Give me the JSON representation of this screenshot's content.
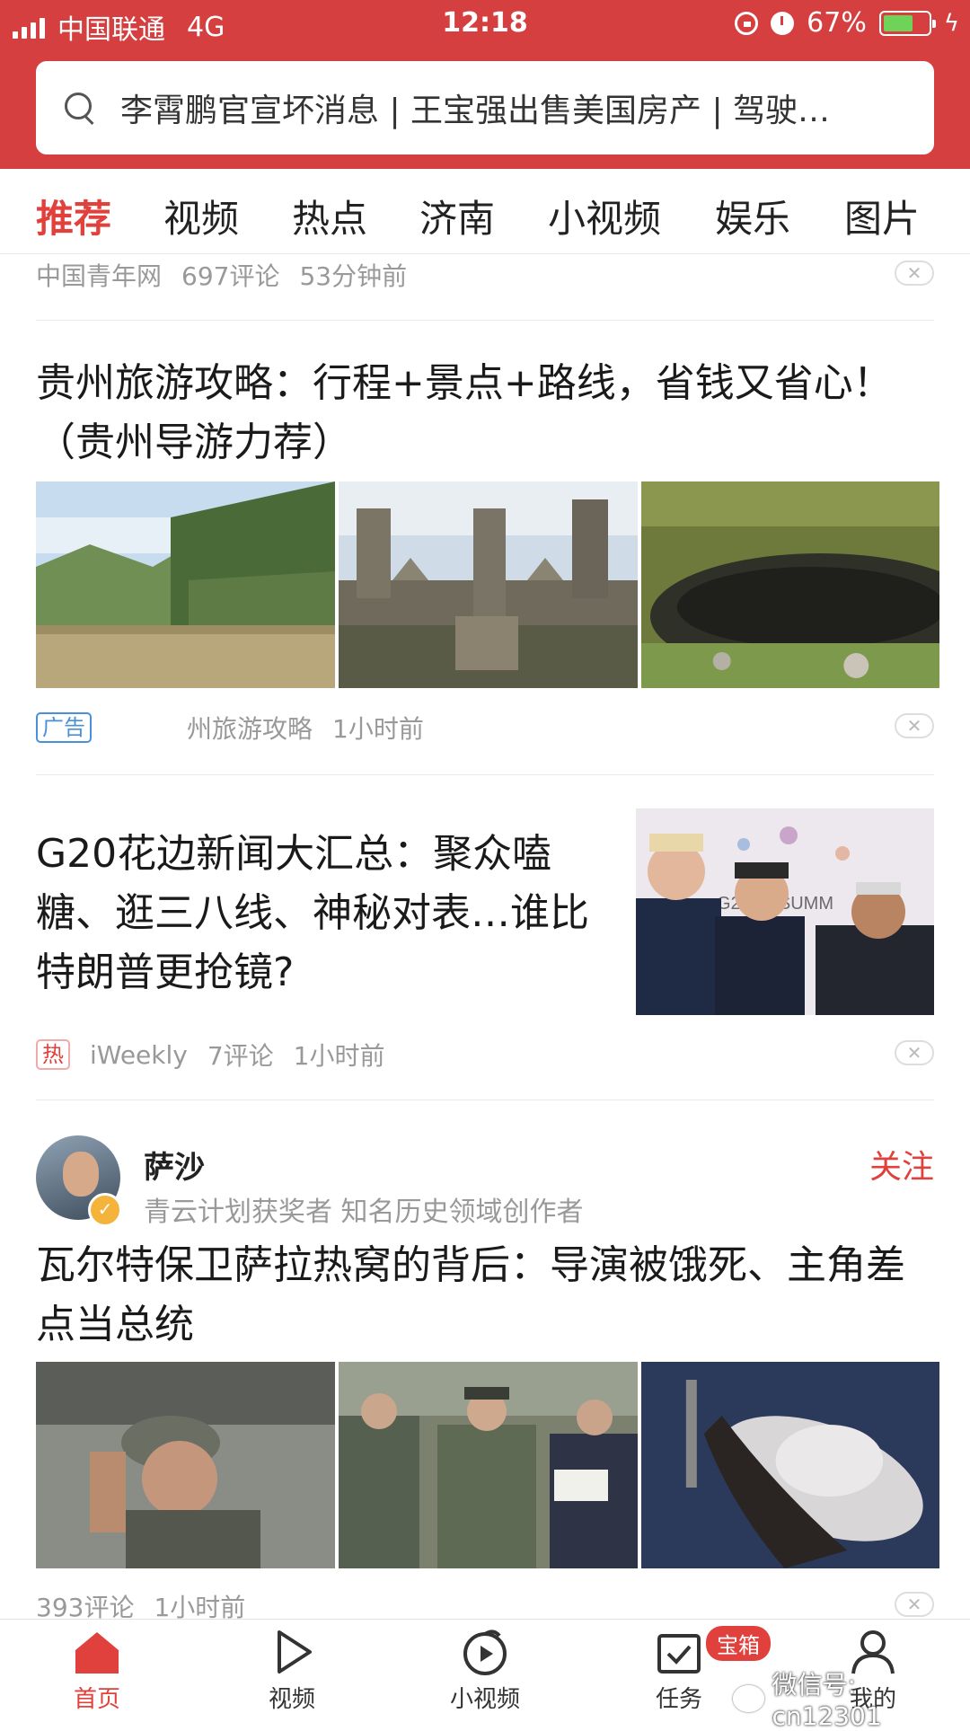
{
  "status_bar": {
    "carrier": "中国联通",
    "network": "4G",
    "time": "12:18",
    "battery": "67%",
    "battery_level": 0.67
  },
  "search": {
    "text": "李霄鹏官宣坏消息 | 王宝强出售美国房产 | 驾驶…"
  },
  "tabs": [
    "推荐",
    "视频",
    "热点",
    "济南",
    "小视频",
    "娱乐",
    "图片"
  ],
  "feed": {
    "top_meta": {
      "source": "中国青年网",
      "comments": "697评论",
      "time": "53分钟前"
    },
    "ad_article": {
      "title": "贵州旅游攻略：行程+景点+路线，省钱又省心！（贵州导游力荐）",
      "badge": "广告",
      "source": "州旅游攻略",
      "time": "1小时前",
      "images": [
        "river-cliff-photo",
        "stone-sculpture-wall-photo",
        "mossy-cave-photo"
      ]
    },
    "g20_article": {
      "title": "G20花边新闻大汇总：聚众嗑糖、逛三八线、神秘对表…谁比特朗普更抢镜?",
      "badge": "热",
      "source": "iWeekly",
      "comments": "7评论",
      "time": "1小时前",
      "image": "g20-leaders-photo"
    },
    "author_article": {
      "author_name": "萨沙",
      "author_desc": "青云计划获奖者 知名历史领域创作者",
      "follow": "关注",
      "title": "瓦尔特保卫萨拉热窝的背后：导演被饿死、主角差点当总统",
      "comments": "393评论",
      "time": "1小时前",
      "images": [
        "soldier-saluting-photo",
        "officers-group-photo",
        "reclining-woman-photo"
      ]
    }
  },
  "bottom_nav": {
    "items": [
      "首页",
      "视频",
      "小视频",
      "任务",
      "我的"
    ],
    "task_badge": "宝箱"
  },
  "watermark": "微信号: cn12301",
  "colors": {
    "brand_red": "#d63f3f",
    "active_red": "#e0413c"
  }
}
